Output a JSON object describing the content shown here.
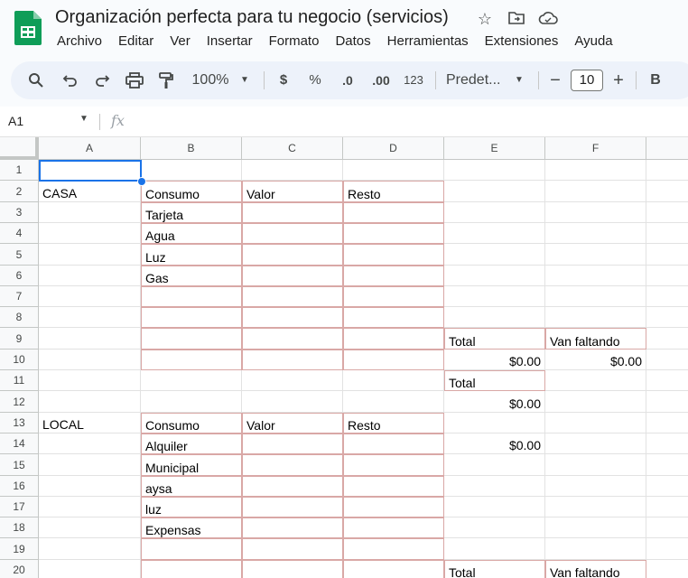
{
  "header": {
    "title": "Organización perfecta para tu negocio (servicios)",
    "title_icons": [
      "star-icon",
      "move-to-folder-icon",
      "cloud-status-icon"
    ],
    "menu": [
      "Archivo",
      "Editar",
      "Ver",
      "Insertar",
      "Formato",
      "Datos",
      "Herramientas",
      "Extensiones",
      "Ayuda"
    ]
  },
  "toolbar": {
    "zoom": "100%",
    "currency": "$",
    "percent": "%",
    "decrease_decimals": ".0",
    "increase_decimals": ".00",
    "number_format": "123",
    "font": "Predet...",
    "font_size_minus": "−",
    "font_size": "10",
    "font_size_plus": "+",
    "bold": "B",
    "icons": [
      "search-icon",
      "undo-icon",
      "redo-icon",
      "print-icon",
      "paint-format-icon"
    ]
  },
  "formula_bar": {
    "cell_ref": "A1",
    "fx": "fx"
  },
  "columns": [
    "A",
    "B",
    "C",
    "D",
    "E",
    "F"
  ],
  "rows": [
    "1",
    "2",
    "3",
    "4",
    "5",
    "6",
    "7",
    "8",
    "9",
    "10",
    "11",
    "12",
    "13",
    "14",
    "15",
    "16",
    "17",
    "18",
    "19",
    "20"
  ],
  "cells": {
    "A2": "CASA",
    "B2": "Consumo",
    "C2": "Valor",
    "D2": "Resto",
    "B3": "Tarjeta",
    "B4": "Agua",
    "B5": "Luz",
    "B6": "Gas",
    "E9": "Total",
    "F9": "Van faltando",
    "E10": "$0.00",
    "F10": "$0.00",
    "E11": "Total",
    "E12": "$0.00",
    "A13": "LOCAL",
    "B13": "Consumo",
    "C13": "Valor",
    "D13": "Resto",
    "E14": "$0.00",
    "B14": "Alquiler",
    "B15": "Municipal",
    "B16": "aysa",
    "B17": "luz",
    "B18": "Expensas",
    "E20": "Total",
    "F20": "Van faltando"
  },
  "colors": {
    "accent": "#1a73e8",
    "sheets_green": "#0f9d58",
    "cell_border": "#d9a8a6"
  }
}
